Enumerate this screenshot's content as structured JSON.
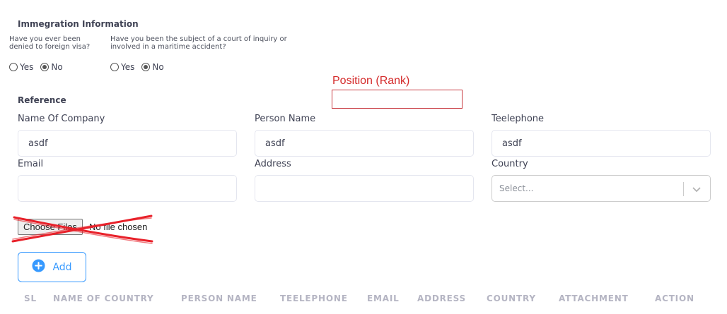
{
  "immigration": {
    "title": "Immegration Information",
    "q1_line1": "Have you ever been",
    "q1_line2": "denied to foreign visa?",
    "q2_line1": "Have you been the subject of a court of inquiry or",
    "q2_line2": "involved in a maritime accident?",
    "yes_label": "Yes",
    "no_label": "No"
  },
  "annotation": {
    "label": "Position (Rank)",
    "color": "#d42a2a"
  },
  "reference": {
    "title": "Reference",
    "company_label": "Name Of Company",
    "company_value": "asdf",
    "person_label": "Person Name",
    "person_value": "asdf",
    "phone_label": "Teelephone",
    "phone_value": "asdf",
    "email_label": "Email",
    "email_value": "",
    "address_label": "Address",
    "address_value": "",
    "country_label": "Country",
    "country_placeholder": "Select..."
  },
  "file": {
    "button_label": "Choose Files",
    "status_text": "No file chosen"
  },
  "add_button": {
    "label": "Add",
    "color": "#3699ff"
  },
  "table": {
    "headers": [
      "SL",
      "NAME OF COUNTRY",
      "PERSON NAME",
      "TEELEPHONE",
      "EMAIL",
      "ADDRESS",
      "COUNTRY",
      "ATTACHMENT",
      "ACTION"
    ]
  }
}
